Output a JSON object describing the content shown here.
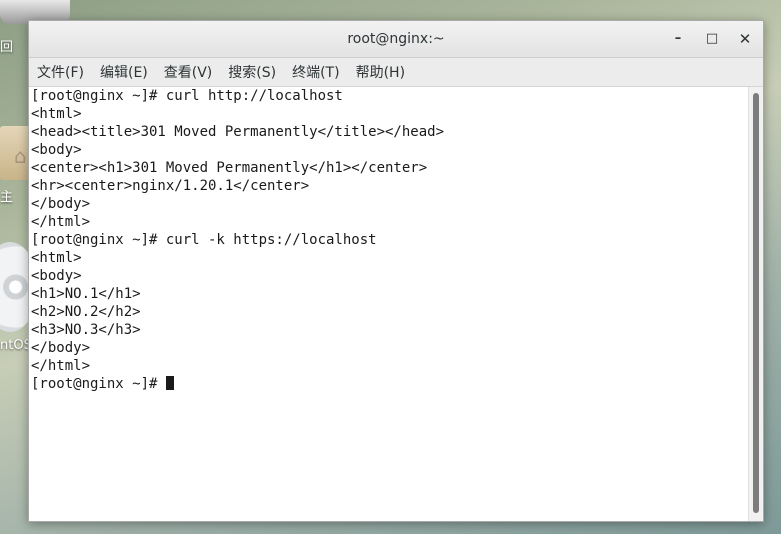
{
  "desktop": {
    "labels": [
      "回",
      "主",
      "ntOS"
    ]
  },
  "window": {
    "title": "root@nginx:~",
    "buttons": {
      "minimize": "–",
      "maximize": "□",
      "close": "✕"
    }
  },
  "menubar": {
    "items": [
      "文件(F)",
      "编辑(E)",
      "查看(V)",
      "搜索(S)",
      "终端(T)",
      "帮助(H)"
    ]
  },
  "terminal": {
    "lines": [
      "[root@nginx ~]# curl http://localhost",
      "<html>",
      "<head><title>301 Moved Permanently</title></head>",
      "<body>",
      "<center><h1>301 Moved Permanently</h1></center>",
      "<hr><center>nginx/1.20.1</center>",
      "</body>",
      "</html>",
      "[root@nginx ~]# curl -k https://localhost",
      "<html>",
      "<body>",
      "<h1>NO.1</h1>",
      "<h2>NO.2</h2>",
      "<h3>NO.3</h3>",
      "</body>",
      "</html>",
      "[root@nginx ~]# "
    ]
  },
  "colors": {
    "terminal_bg": "#ffffff",
    "terminal_fg": "#1a1a1a",
    "titlebar_bg": "#e8e8e8"
  }
}
